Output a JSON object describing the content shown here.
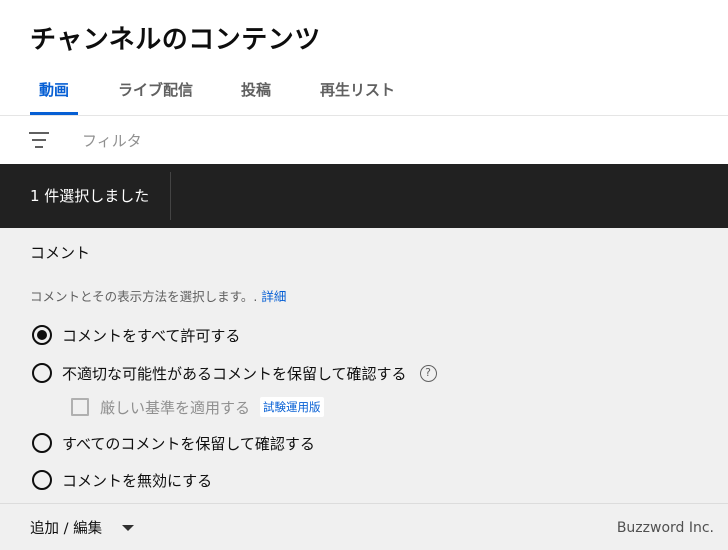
{
  "page": {
    "title": "チャンネルのコンテンツ"
  },
  "tabs": [
    {
      "label": "動画",
      "active": true
    },
    {
      "label": "ライブ配信",
      "active": false
    },
    {
      "label": "投稿",
      "active": false
    },
    {
      "label": "再生リスト",
      "active": false
    }
  ],
  "filter": {
    "icon": "filter-icon",
    "placeholder": "フィルタ"
  },
  "selection": {
    "text": "1 件選択しました"
  },
  "comments": {
    "title": "コメント",
    "description": "コメントとその表示方法を選択します。.",
    "details_link": "詳細",
    "options": [
      {
        "label": "コメントをすべて許可する",
        "checked": true
      },
      {
        "label": "不適切な可能性があるコメントを保留して確認する",
        "checked": false
      },
      {
        "label": "すべてのコメントを保留して確認する",
        "checked": false
      },
      {
        "label": "コメントを無効にする",
        "checked": false
      }
    ],
    "help_icon": "help-icon",
    "strict_checkbox": {
      "label": "厳しい基準を適用する",
      "checked": false,
      "badge": "試験運用版"
    }
  },
  "footer": {
    "dropdown_label": "追加 / 編集",
    "watermark": "Buzzword Inc."
  },
  "colors": {
    "accent": "#065fd4",
    "selection_bar": "#212121",
    "panel_bg": "#f0f0f0"
  }
}
